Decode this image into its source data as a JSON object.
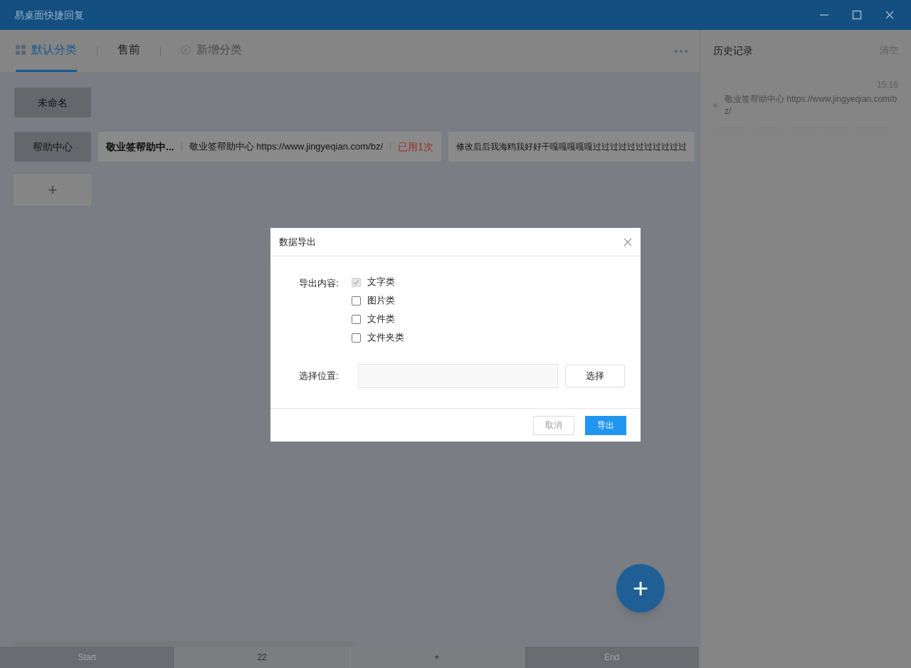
{
  "window": {
    "title": "易桌面快捷回复"
  },
  "tabs": [
    {
      "label": "默认分类",
      "selected": true,
      "kind": "grid"
    },
    {
      "label": "售前",
      "selected": false,
      "kind": "plain"
    },
    {
      "label": "新增分类",
      "selected": false,
      "kind": "add"
    }
  ],
  "groups": [
    {
      "name": "未命名"
    },
    {
      "name": "帮助中心",
      "snippets": [
        {
          "title": "敬业签帮助中...",
          "content": "敬业签帮助中心 https://www.jingyeqian.com/bz/",
          "usage": "已用1次"
        },
        {
          "content": "修改后后我海鸥我好好干嘎嘎嘎嘎嘎过过过过过过过过过过过"
        }
      ]
    }
  ],
  "add_group_button": "+",
  "fab": "+",
  "history": {
    "title": "历史记录",
    "clear": "清空",
    "entries": [
      {
        "time": "15:16",
        "text": "敬业签帮助中心 https://www.jingyeqian.com/bz/"
      }
    ]
  },
  "pager": [
    {
      "label": "Start",
      "disabled": true
    },
    {
      "label": "22",
      "disabled": false
    },
    {
      "label": "+",
      "disabled": false
    },
    {
      "label": "End",
      "disabled": true
    }
  ],
  "dialog": {
    "title": "数据导出",
    "content_label": "导出内容:",
    "options": [
      {
        "label": "文字类",
        "checked": true,
        "disabled": true
      },
      {
        "label": "图片类",
        "checked": false,
        "disabled": false
      },
      {
        "label": "文件类",
        "checked": false,
        "disabled": false
      },
      {
        "label": "文件夹类",
        "checked": false,
        "disabled": false
      }
    ],
    "location_label": "选择位置:",
    "choose_button": "选择",
    "cancel_button": "取消",
    "export_button": "导出"
  }
}
